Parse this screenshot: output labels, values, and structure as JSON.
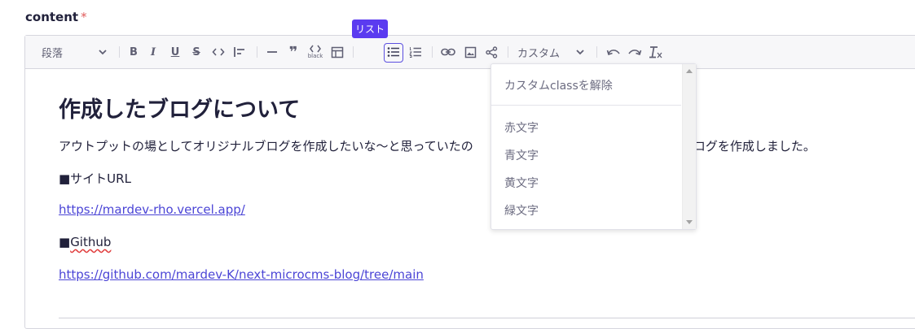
{
  "field": {
    "label": "content",
    "required_mark": "*"
  },
  "toolbar": {
    "paragraph_select": "段落",
    "custom_select": "カスタム",
    "code_block_sub": "black",
    "tooltip": "リスト"
  },
  "editor": {
    "heading": "作成したブログについて",
    "intro": "アウトプットの場としてオリジナルブログを作成したいな〜と思っていたの",
    "intro_tail": "でブログを作成しました。",
    "site_label": "■サイトURL",
    "site_url": "https://mardev-rho.vercel.app/",
    "github_prefix": "■",
    "github_word": "Github",
    "github_url": "https://github.com/mardev-K/next-microcms-blog/tree/main"
  },
  "dropdown": {
    "clear": "カスタムclassを解除",
    "items": [
      "赤文字",
      "青文字",
      "黄文字",
      "緑文字"
    ]
  }
}
